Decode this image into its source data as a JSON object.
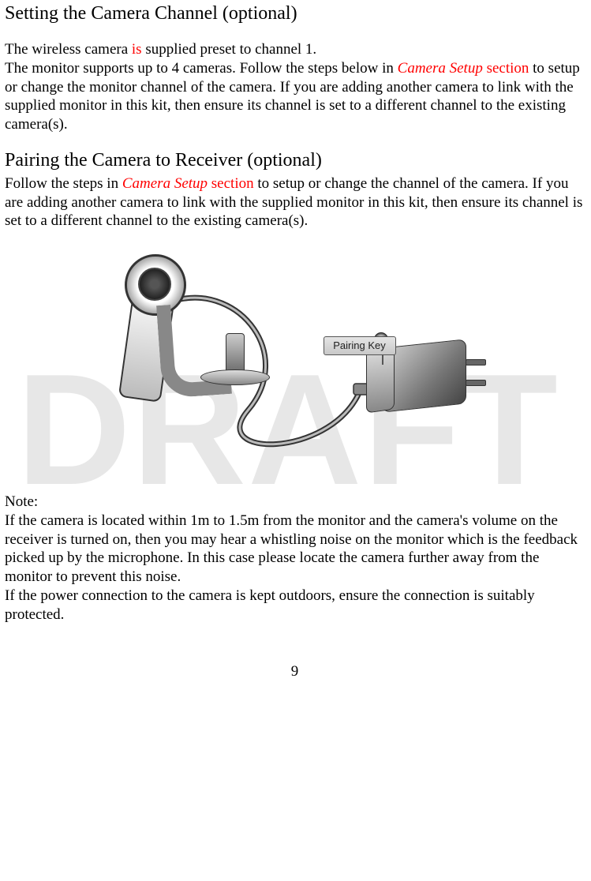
{
  "watermark": "DRAFT",
  "heading1": "Setting the Camera Channel (optional)",
  "p1_a": "The wireless camera ",
  "p1_is": "is",
  "p1_b": " supplied preset to channel 1.",
  "p2_a": "The monitor supports up to 4 cameras. Follow the steps below in ",
  "p2_link": "Camera Setup",
  "p2_section": " section",
  "p2_b": " to setup or change the monitor channel of the camera. If you are adding another camera to link with the supplied monitor in this kit, then ensure its channel is set to a different channel to the existing camera(s).",
  "heading2": "Pairing the Camera to Receiver (optional)",
  "p3_a": "Follow the steps in ",
  "p3_link": "Camera Setup",
  "p3_section": " section",
  "p3_b": " to setup or change the channel of the camera. If you are adding another camera to link with the supplied monitor in this kit, then ensure its channel is set to a different channel to the existing camera(s).",
  "figure_label": "Pairing Key",
  "note_title": "Note:",
  "note_p1": "If the camera is located within 1m to 1.5m from the monitor and the camera's volume on the receiver is turned on, then you may hear a whistling noise on the monitor which is the feedback picked up by the microphone. In this case please locate the camera further away from the monitor to prevent this noise.",
  "note_p2": "If the power connection to the camera is kept outdoors, ensure the connection is suitably protected.",
  "page_number": "9"
}
